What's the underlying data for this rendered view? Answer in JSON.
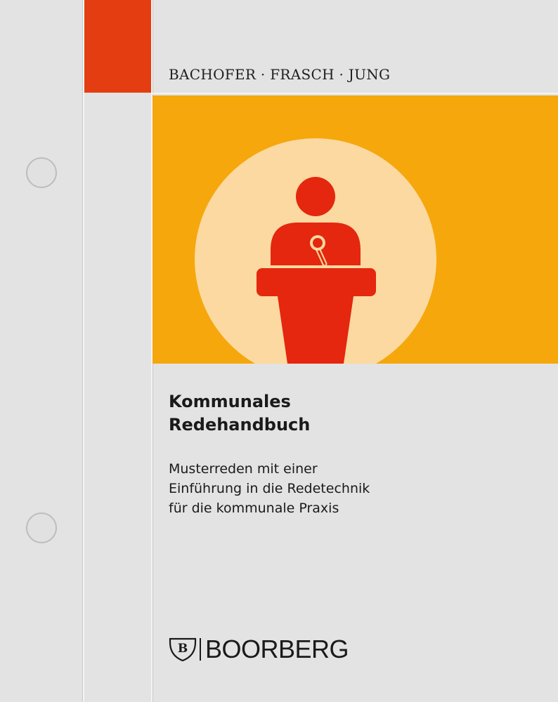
{
  "cover": {
    "authors": "BACHOFER · FRASCH · JUNG",
    "title_lines": [
      "Kommunales",
      "Redehandbuch"
    ],
    "subtitle_lines": [
      "Musterreden mit einer",
      "Einführung in die Redetechnik",
      "für die kommunale Praxis"
    ],
    "illustration": "speaker-at-podium-icon",
    "publisher": {
      "name": "BOORBERG",
      "emblem": "B"
    }
  },
  "colors": {
    "background": "#e3e3e3",
    "accent_red": "#e43d12",
    "banner_orange": "#f5a70c",
    "spotlight_cream": "#fcd9a0",
    "speaker_red": "#e4270e",
    "text": "#1a1a1a"
  }
}
